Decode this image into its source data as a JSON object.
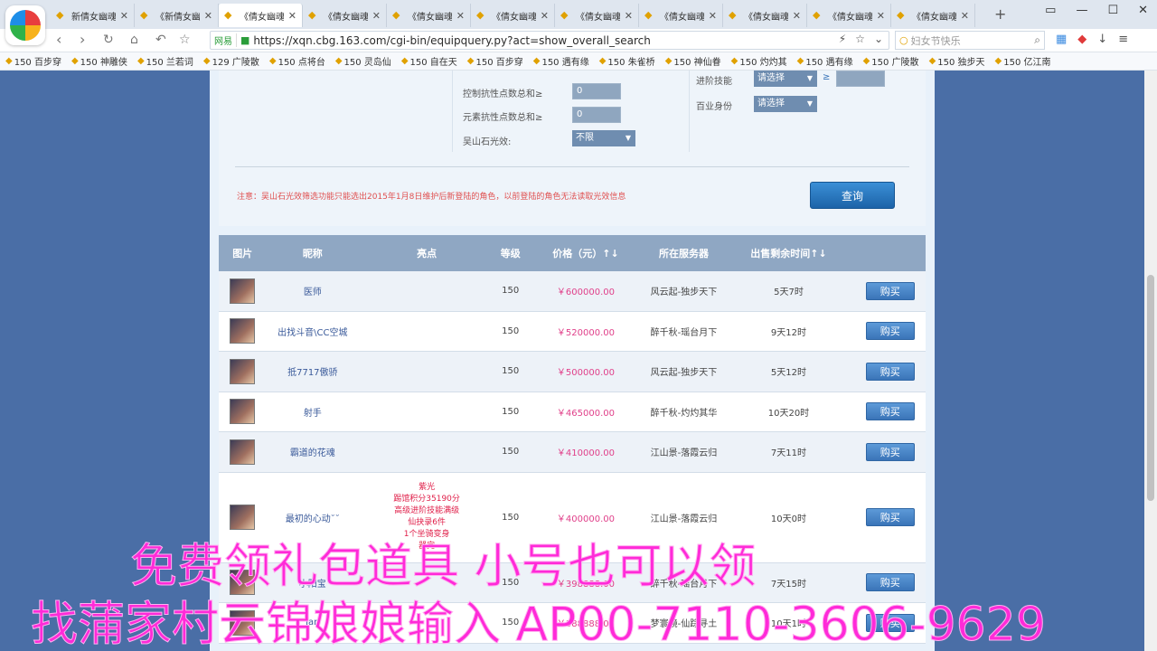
{
  "browser": {
    "tabs": [
      {
        "label": "新倩女幽魂",
        "active": false
      },
      {
        "label": "《新倩女幽",
        "active": false
      },
      {
        "label": "《倩女幽魂",
        "active": true
      },
      {
        "label": "《倩女幽魂",
        "active": false
      },
      {
        "label": "《倩女幽魂",
        "active": false
      },
      {
        "label": "《倩女幽魂",
        "active": false
      },
      {
        "label": "《倩女幽魂",
        "active": false
      },
      {
        "label": "《倩女幽魂",
        "active": false
      },
      {
        "label": "《倩女幽魂",
        "active": false
      },
      {
        "label": "《倩女幽魂",
        "active": false
      },
      {
        "label": "《倩女幽魂",
        "active": false
      }
    ],
    "safe_badge": "网易",
    "url": "https://xqn.cbg.163.com/cgi-bin/equipquery.py?act=show_overall_search",
    "search_placeholder": "妇女节快乐",
    "bookmarks": [
      "150 百步穿",
      "150 神雕侠",
      "150 兰若词",
      "129 广陵散",
      "150 点将台",
      "150 灵岛仙",
      "150 自在天",
      "150 百步穿",
      "150 遇有缘",
      "150 朱雀桥",
      "150 神仙眷",
      "150 灼灼其",
      "150 遇有缘",
      "150 广陵散",
      "150 独步天",
      "150 亿江南"
    ]
  },
  "filters": {
    "control_resist_label": "控制抗性点数总和≥",
    "control_resist_value": "0",
    "element_resist_label": "元素抗性点数总和≥",
    "element_resist_value": "0",
    "wushan_label": "吴山石光效:",
    "wushan_value": "不限",
    "advanced_skill_label": "进阶技能",
    "advanced_skill_value": "请选择",
    "profession_label": "百业身份",
    "profession_value": "请选择",
    "gte_symbol": "≥",
    "notice": "注意：吴山石光效筛选功能只能选出2015年1月8日维护后新登陆的角色，以前登陆的角色无法读取光效信息",
    "query_button": "查询"
  },
  "table": {
    "headers": {
      "image": "图片",
      "name": "昵称",
      "highlight": "亮点",
      "level": "等级",
      "price": "价格（元）↑↓",
      "server": "所在服务器",
      "time": "出售剩余时间↑↓"
    },
    "buy_label": "购买",
    "rows": [
      {
        "name": "医师",
        "highlight": [],
        "level": "150",
        "price": "￥600000.00",
        "server": "风云起-独步天下",
        "time": "5天7时"
      },
      {
        "name": "出找斗音\\CC空城",
        "highlight": [],
        "level": "150",
        "price": "￥520000.00",
        "server": "醉千秋-瑶台月下",
        "time": "9天12时"
      },
      {
        "name": "抵7717傲骄",
        "highlight": [],
        "level": "150",
        "price": "￥500000.00",
        "server": "风云起-独步天下",
        "time": "5天12时"
      },
      {
        "name": "射手",
        "highlight": [],
        "level": "150",
        "price": "￥465000.00",
        "server": "醉千秋-灼灼其华",
        "time": "10天20时"
      },
      {
        "name": "霸道的花魂",
        "highlight": [],
        "level": "150",
        "price": "￥410000.00",
        "server": "江山景-落霞云归",
        "time": "7天11时"
      },
      {
        "name": "最初的心动˘˘",
        "highlight": [
          "紫光",
          "踢馆积分35190分",
          "高级进阶技能满级",
          "仙抉录6件",
          "1个坐骑变身",
          "器完"
        ],
        "level": "150",
        "price": "￥400000.00",
        "server": "江山景-落霞云归",
        "time": "10天0时"
      },
      {
        "name": "小阳宝",
        "highlight": [],
        "level": "150",
        "price": "￥398888.00",
        "server": "醉千秋-瑶台月下",
        "time": "7天15时"
      },
      {
        "name": "Jan",
        "highlight": [],
        "level": "150",
        "price": "￥388888.00",
        "server": "梦寰镜-仙踪寻土",
        "time": "10天1时"
      }
    ]
  },
  "overlay": {
    "line1": "免费领礼包道具 小号也可以领",
    "line2": "找蒲家村云锦娘娘输入 AP00-7110-3606-9629"
  },
  "colors": {
    "page_bg": "#4a6ea6",
    "header_bg": "#8fa7c3",
    "price": "#e0408a",
    "overlay": "#ff2ad8",
    "query_button": "#1c63a8"
  }
}
